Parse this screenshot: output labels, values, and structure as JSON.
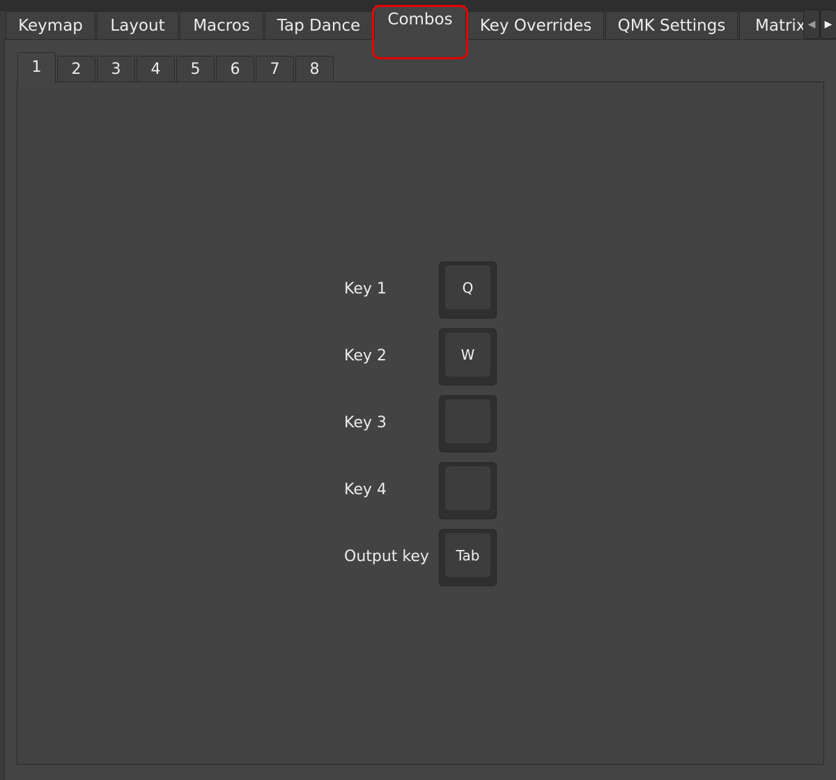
{
  "main_tabs": [
    {
      "label": "Keymap"
    },
    {
      "label": "Layout"
    },
    {
      "label": "Macros"
    },
    {
      "label": "Tap Dance"
    },
    {
      "label": "Combos",
      "active": true
    },
    {
      "label": "Key Overrides"
    },
    {
      "label": "QMK Settings"
    },
    {
      "label": "Matrix"
    }
  ],
  "tab_scroll": {
    "left_icon": "chevron-left-icon",
    "right_icon": "chevron-right-icon",
    "left_glyph": "◀",
    "right_glyph": "▶"
  },
  "combo_tabs": [
    {
      "label": "1",
      "active": true
    },
    {
      "label": "2"
    },
    {
      "label": "3"
    },
    {
      "label": "4"
    },
    {
      "label": "5"
    },
    {
      "label": "6"
    },
    {
      "label": "7"
    },
    {
      "label": "8"
    }
  ],
  "combo": {
    "rows": [
      {
        "label": "Key 1",
        "key": "Q"
      },
      {
        "label": "Key 2",
        "key": "W"
      },
      {
        "label": "Key 3",
        "key": ""
      },
      {
        "label": "Key 4",
        "key": ""
      },
      {
        "label": "Output key",
        "key": "Tab"
      }
    ]
  },
  "colors": {
    "background": "#3b3b3b",
    "panel": "#444444",
    "text": "#ececec",
    "highlight": "#e60000"
  }
}
